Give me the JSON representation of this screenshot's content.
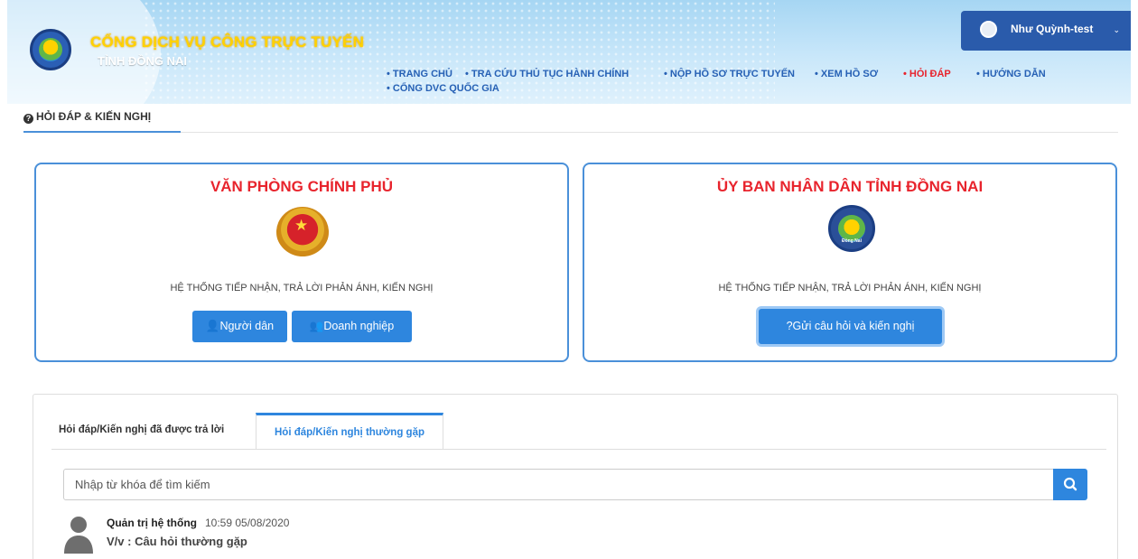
{
  "header": {
    "brand_title": "CỔNG DỊCH VỤ CÔNG TRỰC TUYẾN",
    "brand_subtitle": "TỈNH ĐỒNG NAI",
    "logo_text": "Đồng Nai"
  },
  "user": {
    "name": "Như Quỳnh-test",
    "caret": "⌄"
  },
  "nav": {
    "items": [
      {
        "label": "• TRANG CHỦ"
      },
      {
        "label": "• TRA CỨU THỦ TỤC HÀNH CHÍNH"
      },
      {
        "label": "• NỘP HỒ SƠ TRỰC TUYẾN"
      },
      {
        "label": "• XEM HỒ SƠ"
      },
      {
        "label": "• HỎI ĐÁP"
      },
      {
        "label": "• HƯỚNG DẪN"
      },
      {
        "label": "• CỔNG DVC QUỐC GIA"
      }
    ],
    "active_index": 4
  },
  "breadcrumb": {
    "label": "HỎI ĐÁP & KIẾN NGHỊ"
  },
  "cards": {
    "left": {
      "title": "VĂN PHÒNG CHÍNH PHỦ",
      "subtitle": "HỆ THỐNG TIẾP NHẬN, TRẢ LỜI PHẢN ÁNH, KIẾN NGHỊ",
      "btn_people": "Người dân",
      "btn_business": "Doanh nghiệp"
    },
    "right": {
      "title": "ỦY BAN NHÂN DÂN TỈNH ĐỒNG NAI",
      "subtitle": "HỆ THỐNG TIẾP NHẬN, TRẢ LỜI PHẢN ÁNH, KIẾN NGHỊ",
      "btn_send": "Gửi câu hỏi và kiến nghị"
    }
  },
  "tabs": {
    "answered": "Hỏi đáp/Kiến nghị đã được trả lời",
    "faq": "Hỏi đáp/Kiến nghị thường gặp"
  },
  "search": {
    "placeholder": "Nhập từ khóa để tìm kiếm",
    "value": ""
  },
  "post": {
    "author": "Quản trị hệ thống",
    "time": "10:59 05/08/2020",
    "subject": "V/v : Câu hỏi thường gặp"
  },
  "colors": {
    "accent": "#2e86de",
    "nav": "#2761b5",
    "active": "#e8242d",
    "title_red": "#e8242d",
    "brand_yellow": "#ffd200"
  },
  "icons": [
    "question-circle-icon",
    "user-icon",
    "users-icon",
    "search-icon",
    "avatar-icon",
    "chevron-down-icon"
  ]
}
